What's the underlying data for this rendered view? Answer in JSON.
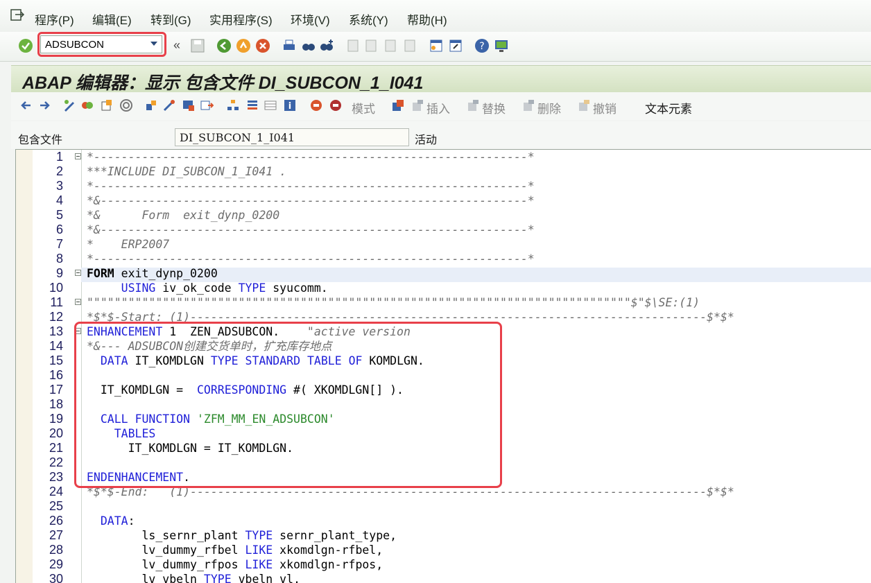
{
  "menu": {
    "items": [
      "程序(P)",
      "编辑(E)",
      "转到(G)",
      "实用程序(S)",
      "环境(V)",
      "系统(Y)",
      "帮助(H)"
    ]
  },
  "toolbar": {
    "command_value": "ADSUBCON"
  },
  "title": "ABAP 编辑器：显示 包含文件 DI_SUBCON_1_I041",
  "app_toolbar": {
    "mode_label": "模式",
    "insert_label": "插入",
    "replace_label": "替换",
    "delete_label": "删除",
    "undo_label": "撤销",
    "text_elements_label": "文本元素"
  },
  "include_field": {
    "label": "包含文件",
    "value": "DI_SUBCON_1_I041",
    "status": "活动"
  },
  "code_lines": [
    {
      "n": "1",
      "t": "*---------------------------------------------------------------*",
      "c": "cmt"
    },
    {
      "n": "2",
      "t": "***INCLUDE DI_SUBCON_1_I041 .",
      "c": "cmt"
    },
    {
      "n": "3",
      "t": "*---------------------------------------------------------------*",
      "c": "cmt"
    },
    {
      "n": "4",
      "t": "*&--------------------------------------------------------------*",
      "c": "cmt"
    },
    {
      "n": "5",
      "t": "*&      Form  exit_dynp_0200",
      "c": "cmt"
    },
    {
      "n": "6",
      "t": "*&--------------------------------------------------------------*",
      "c": "cmt"
    },
    {
      "n": "7",
      "t": "*    ERP2007",
      "c": "cmt"
    },
    {
      "n": "8",
      "t": "*---------------------------------------------------------------*",
      "c": "cmt"
    },
    {
      "n": "9",
      "t": "FORM exit_dynp_0200",
      "c": ""
    },
    {
      "n": "10",
      "t": "     USING iv_ok_code TYPE syucomm.",
      "c": ""
    },
    {
      "n": "11",
      "t": "\"\"\"\"\"\"\"\"\"\"\"\"\"\"\"\"\"\"\"\"\"\"\"\"\"\"\"\"\"\"\"\"\"\"\"\"\"\"\"\"\"\"\"\"\"\"\"\"\"\"\"\"\"\"\"\"\"\"\"\"\"\"\"\"\"\"\"\"\"\"\"\"\"\"\"\"\"\"\"$\"$\\SE:(1)",
      "c": "cmt"
    },
    {
      "n": "12",
      "t": "*$*$-Start: (1)---------------------------------------------------------------------------$*$*",
      "c": "cmt"
    },
    {
      "n": "13",
      "t": "ENHANCEMENT 1  ZEN_ADSUBCON.    \"active version",
      "c": ""
    },
    {
      "n": "14",
      "t": "*&--- ADSUBCON创建交货单时，扩充库存地点",
      "c": "cmt"
    },
    {
      "n": "15",
      "t": "  DATA IT_KOMDLGN TYPE STANDARD TABLE OF KOMDLGN.",
      "c": ""
    },
    {
      "n": "16",
      "t": "",
      "c": ""
    },
    {
      "n": "17",
      "t": "  IT_KOMDLGN =  CORRESPONDING #( XKOMDLGN[] ).",
      "c": ""
    },
    {
      "n": "18",
      "t": "",
      "c": ""
    },
    {
      "n": "19",
      "t": "  CALL FUNCTION 'ZFM_MM_EN_ADSUBCON'",
      "c": ""
    },
    {
      "n": "20",
      "t": "    TABLES",
      "c": ""
    },
    {
      "n": "21",
      "t": "      IT_KOMDLGN = IT_KOMDLGN.",
      "c": ""
    },
    {
      "n": "22",
      "t": "",
      "c": ""
    },
    {
      "n": "23",
      "t": "ENDENHANCEMENT.",
      "c": ""
    },
    {
      "n": "24",
      "t": "*$*$-End:   (1)---------------------------------------------------------------------------$*$*",
      "c": "cmt"
    },
    {
      "n": "25",
      "t": "",
      "c": ""
    },
    {
      "n": "26",
      "t": "  DATA:",
      "c": ""
    },
    {
      "n": "27",
      "t": "        ls_sernr_plant TYPE sernr_plant_type,",
      "c": ""
    },
    {
      "n": "28",
      "t": "        lv_dummy_rfbel LIKE xkomdlgn-rfbel,",
      "c": ""
    },
    {
      "n": "29",
      "t": "        lv_dummy_rfpos LIKE xkomdlgn-rfpos,",
      "c": ""
    },
    {
      "n": "30",
      "t": "        lv_vbeln TYPE vbeln_vl,",
      "c": ""
    }
  ]
}
